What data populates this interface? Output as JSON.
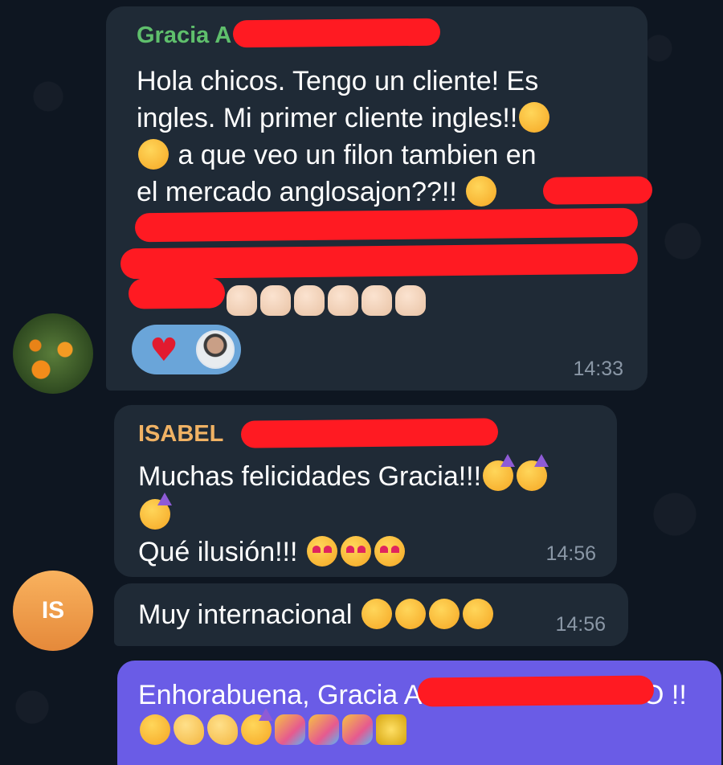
{
  "messages": {
    "m1": {
      "sender": "Gracia A",
      "sender_color": "#5fbf6c",
      "lines": [
        "Hola chicos. Tengo un cliente! Es",
        "ingles. Mi primer cliente ingles!!",
        "a que veo un filon tambien en",
        "el mercado anglosajon??!!"
      ],
      "time": "14:33",
      "reaction": "♥"
    },
    "m2": {
      "sender": "ISABEL",
      "sender_color": "#f0b264",
      "lines": [
        "Muchas felicidades Gracia!!!",
        "Qué ilusión!!!"
      ],
      "time": "14:56"
    },
    "m3": {
      "lines": [
        "Muy internacional"
      ],
      "time": "14:56",
      "avatar_initials": "IS"
    },
    "m4": {
      "lines": [
        "Enhorabuena, Gracia A",
        "O  !!"
      ],
      "bubble_color": "#6a5ce6"
    }
  }
}
